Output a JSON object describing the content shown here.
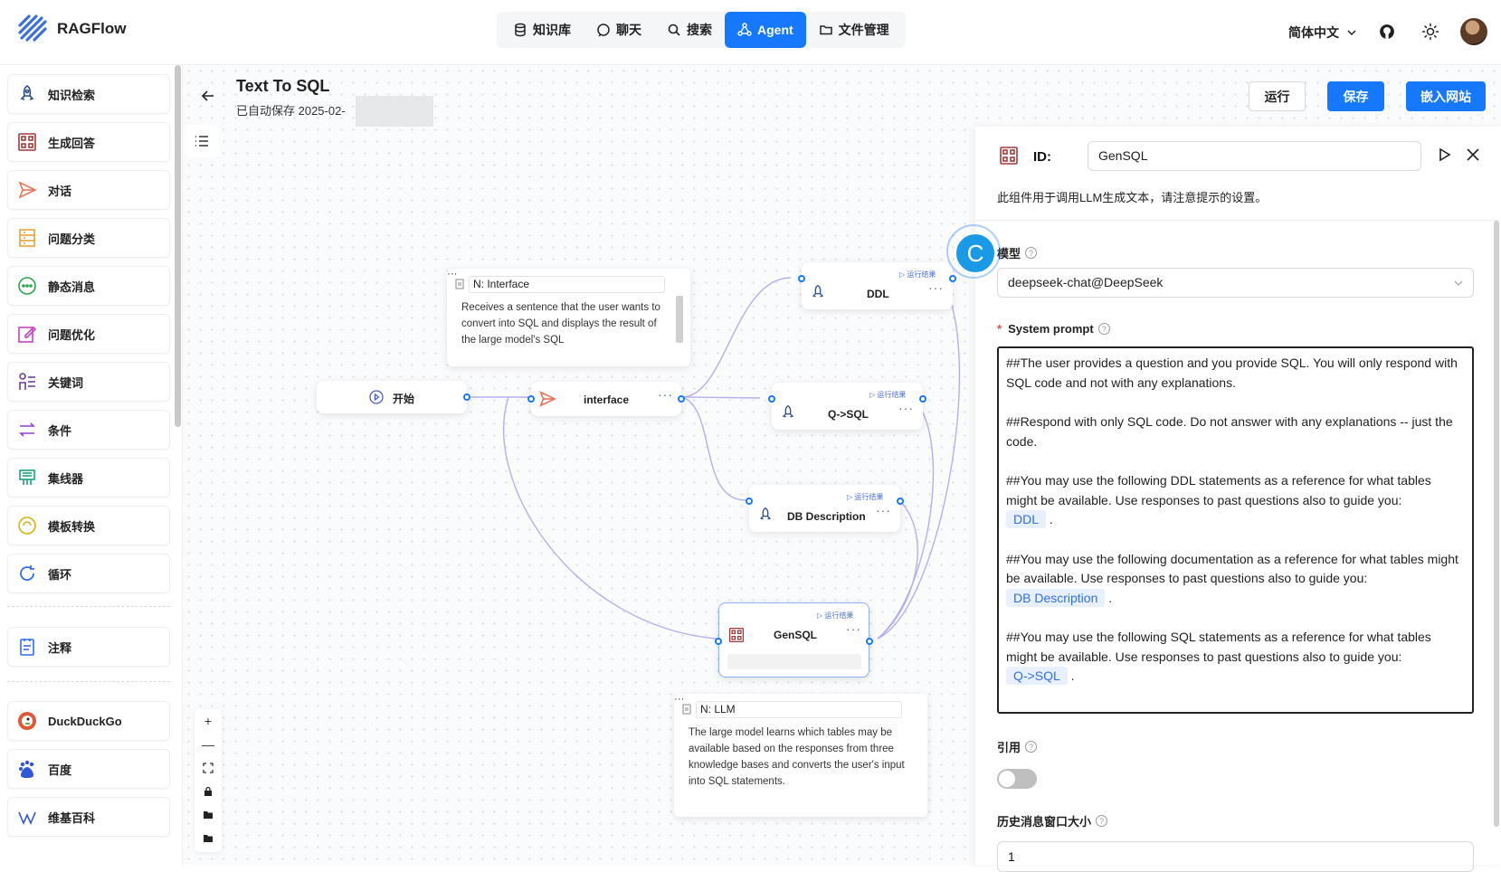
{
  "app": {
    "name": "RAGFlow"
  },
  "nav": {
    "tabs": [
      {
        "label": "知识库",
        "icon": "database-icon"
      },
      {
        "label": "聊天",
        "icon": "chat-icon"
      },
      {
        "label": "搜索",
        "icon": "search-icon"
      },
      {
        "label": "Agent",
        "icon": "agent-icon",
        "active": true
      },
      {
        "label": "文件管理",
        "icon": "folder-icon"
      }
    ],
    "language": "简体中文"
  },
  "sidebar": {
    "operators": [
      {
        "label": "知识检索",
        "icon": "rocket-icon",
        "color": "#2b4a8b"
      },
      {
        "label": "生成回答",
        "icon": "generate-icon",
        "color": "#a33a3a"
      },
      {
        "label": "对话",
        "icon": "send-icon",
        "color": "#e8745a"
      },
      {
        "label": "问题分类",
        "icon": "categorize-icon",
        "color": "#e4a13a"
      },
      {
        "label": "静态消息",
        "icon": "message-icon",
        "color": "#2ea44f"
      },
      {
        "label": "问题优化",
        "icon": "edit-icon",
        "color": "#c444c4"
      },
      {
        "label": "关键词",
        "icon": "keyword-icon",
        "color": "#6b3fa0"
      },
      {
        "label": "条件",
        "icon": "switch-icon",
        "color": "#8b45d6"
      },
      {
        "label": "集线器",
        "icon": "concentrator-icon",
        "color": "#1aa37a"
      },
      {
        "label": "模板转换",
        "icon": "template-icon",
        "color": "#d6b21a"
      },
      {
        "label": "循环",
        "icon": "loop-icon",
        "color": "#2f6fe8"
      }
    ],
    "note_op": {
      "label": "注释",
      "icon": "note-icon"
    },
    "tools": [
      {
        "label": "DuckDuckGo",
        "icon": "duckduckgo-icon"
      },
      {
        "label": "百度",
        "icon": "baidu-icon"
      },
      {
        "label": "维基百科",
        "icon": "wikipedia-icon"
      }
    ]
  },
  "flow": {
    "title": "Text To SQL",
    "autosave": "已自动保存 2025-02-",
    "buttons": {
      "run": "运行",
      "save": "保存",
      "embed": "嵌入网站"
    },
    "run_result_label": "运行结果",
    "nodes": {
      "begin": "开始",
      "interface": "interface",
      "ddl": "DDL",
      "qsql": "Q->SQL",
      "dbdesc": "DB Description",
      "gensql": "GenSQL"
    },
    "notes": [
      {
        "title": "N: Interface",
        "body": "Receives a sentence that the user wants to convert into SQL and displays the result of the large model's SQL"
      },
      {
        "title": "N: LLM",
        "body": "The large model learns which tables may be available based on the responses from three knowledge bases and converts the user's input into SQL statements."
      }
    ],
    "zoom_controls": [
      "+",
      "—"
    ]
  },
  "panel": {
    "id_label": "ID:",
    "id_value": "GenSQL",
    "description": "此组件用于调用LLM生成文本，请注意提示的设置。",
    "model_label": "模型",
    "model_value": "deepseek-chat@DeepSeek",
    "prompt_label": "System prompt",
    "prompt": [
      {
        "text": "##The user provides a question and you provide SQL. You will only respond with SQL code and not with any explanations.",
        "tag": ""
      },
      {
        "text": "##Respond with only SQL code. Do not answer with any explanations -- just the code.",
        "tag": ""
      },
      {
        "text": "##You may use the following DDL statements as a reference for what tables might be available. Use responses to past questions also to guide you:",
        "tag": "DDL"
      },
      {
        "text": "##You may use the following documentation as a reference for what tables might be available. Use responses to past questions also to guide you:",
        "tag": "DB Description"
      },
      {
        "text": "##You may use the following SQL statements as a reference for what tables might be available. Use responses to past questions also to guide you:",
        "tag": "Q->SQL"
      }
    ],
    "cite_label": "引用",
    "cite_enabled": false,
    "history_label": "历史消息窗口大小",
    "history_value": "1"
  },
  "cursor_label": "C",
  "colors": {
    "accent": "#1677ff",
    "edge": "#b7aef0",
    "tag_bg": "#e8f0fe"
  }
}
